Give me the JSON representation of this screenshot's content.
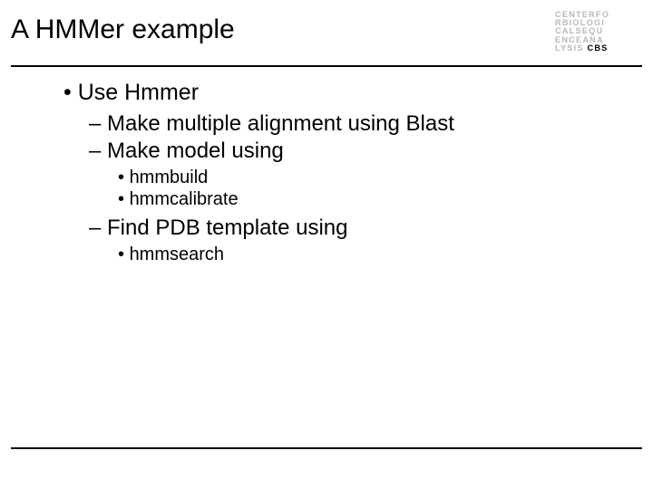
{
  "title": "A HMMer example",
  "logo": {
    "line1": "CENTERFO",
    "line2": "RBIOLOGI",
    "line3": "CALSEQU",
    "line4": "ENCEANA",
    "line5_prefix": "LYSIS",
    "line5_bold": "CBS"
  },
  "bullets": {
    "l1_1": "Use Hmmer",
    "l2_1": "Make multiple alignment using Blast",
    "l2_2": "Make model using",
    "l3_1": "hmmbuild",
    "l3_2": "hmmcalibrate",
    "l2_3": "Find PDB template using",
    "l3_3": "hmmsearch"
  }
}
